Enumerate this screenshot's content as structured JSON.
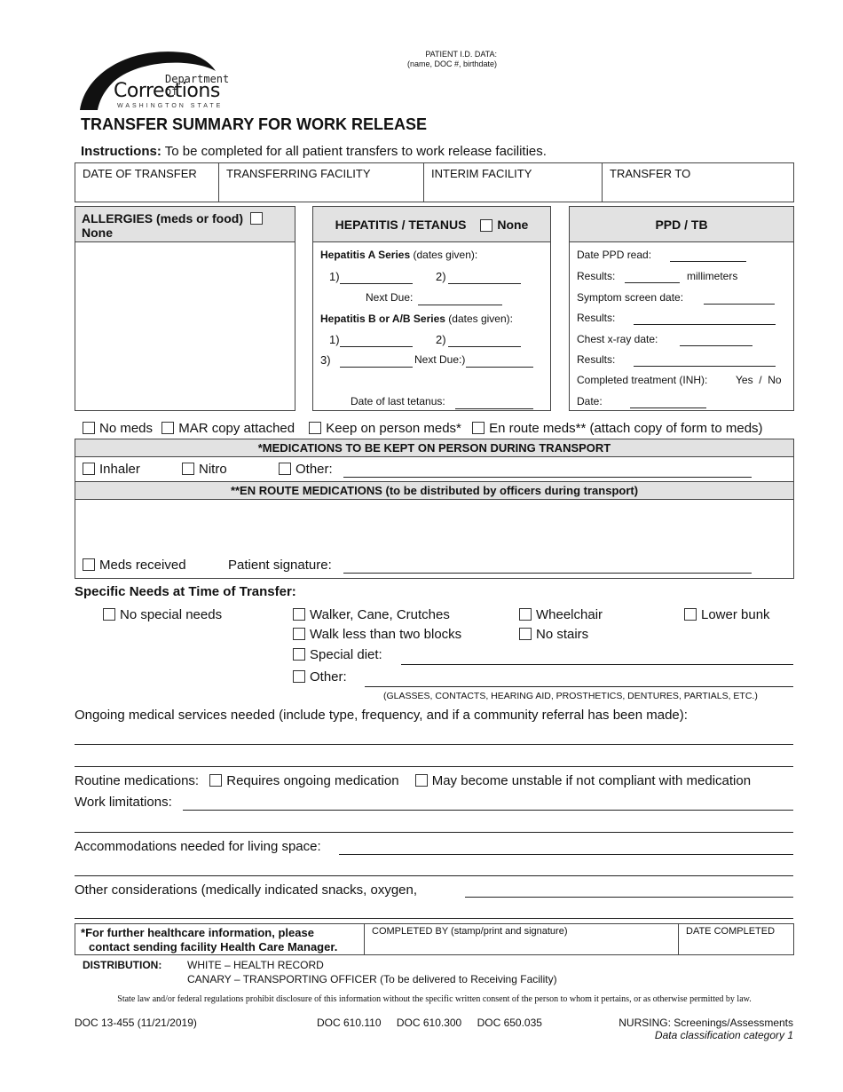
{
  "logo": {
    "line1": "Department of",
    "line2": "Corrections",
    "line3": "WASHINGTON STATE"
  },
  "patient_id": {
    "line1": "PATIENT I.D. DATA:",
    "line2": "(name, DOC #, birthdate)"
  },
  "title": "TRANSFER SUMMARY FOR WORK RELEASE",
  "instructions": {
    "label": "Instructions:",
    "text": " To be completed for all patient transfers to work release facilities."
  },
  "transfer_fields": [
    {
      "label": "DATE OF TRANSFER",
      "value": ""
    },
    {
      "label": "TRANSFERRING FACILITY",
      "value": ""
    },
    {
      "label": "INTERIM FACILITY",
      "value": ""
    },
    {
      "label": "TRANSFER TO",
      "value": ""
    }
  ],
  "allergies": {
    "header": "ALLERGIES (meds or food)",
    "none_label": "None",
    "none_checked": false
  },
  "hepatitis": {
    "header": "HEPATITIS / TETANUS",
    "none_label": "None",
    "none_checked": false,
    "hep_a_title": "Hepatitis A Series",
    "hep_a_sub": " (dates given):",
    "item1": "1)",
    "item2": "2)",
    "item3": "3)",
    "next_due": "Next Due:",
    "next_due_b": "Next Due:)",
    "hep_b_title": "Hepatitis B or A/B Series",
    "hep_b_sub": " (dates given):",
    "tetanus": "Date of last tetanus:"
  },
  "ppd": {
    "header": "PPD / TB",
    "date_read": "Date PPD read:",
    "results": "Results:",
    "millimeters": "millimeters",
    "symptom_date": "Symptom screen date:",
    "xray_date": "Chest x-ray date:",
    "completed": "Completed treatment (INH):",
    "yes_no": "Yes  /  No",
    "date": "Date:"
  },
  "med_options": [
    {
      "label": "No meds",
      "checked": false
    },
    {
      "label": "MAR copy attached",
      "checked": false
    },
    {
      "label": "Keep on person meds*",
      "checked": false
    },
    {
      "label": "En route meds**",
      "checked": false
    }
  ],
  "med_options_note": " (attach copy of form to meds)",
  "keep_on_person": {
    "header": "*MEDICATIONS TO BE KEPT ON PERSON DURING TRANSPORT",
    "inhaler": "Inhaler",
    "nitro": "Nitro",
    "other": "Other:"
  },
  "en_route": {
    "header": "**EN ROUTE MEDICATIONS (to be distributed by officers during transport)",
    "meds_received": "Meds received",
    "patient_signature": "Patient signature:"
  },
  "specific_needs": {
    "title": "Specific Needs at Time of Transfer:",
    "no_special": "No special needs",
    "walker": "Walker, Cane, Crutches",
    "wheelchair": "Wheelchair",
    "lower_bunk": "Lower bunk",
    "walk_less": "Walk less than two blocks",
    "no_stairs": "No stairs",
    "special_diet": "Special diet:",
    "other": "Other:",
    "other_note": "(GLASSES, CONTACTS, HEARING AID, PROSTHETICS, DENTURES, PARTIALS, ETC.)"
  },
  "ongoing": "Ongoing medical services needed (include type, frequency, and if a community referral has been made):",
  "routine": {
    "label": "Routine medications:",
    "requires": "Requires ongoing medication",
    "unstable": "May become unstable if not compliant with medication"
  },
  "work_limitations": "Work limitations:",
  "accommodations": "Accommodations needed for living space:",
  "other_considerations": "Other considerations (medically indicated snacks, oxygen,",
  "footer_box": {
    "note_line1": "For further healthcare information, please",
    "note_line2": "contact sending facility Health Care Manager.",
    "completed_by": "COMPLETED BY (stamp/print and signature)",
    "date_completed": "DATE COMPLETED"
  },
  "distribution": {
    "label": "DISTRIBUTION:",
    "line1": "WHITE – HEALTH RECORD",
    "line2": "CANARY – TRANSPORTING OFFICER (To be delivered to Receiving Facility)"
  },
  "legal": "State law and/or federal regulations prohibit disclosure of this information without the specific written consent of the person to whom it pertains, or as otherwise permitted by law.",
  "footer": {
    "form_id": "DOC 13-455 (11/21/2019)",
    "refs": [
      "DOC 610.110",
      "DOC 610.300",
      "DOC 650.035"
    ],
    "category": "NURSING: Screenings/Assessments",
    "classification": "Data classification category 1"
  }
}
